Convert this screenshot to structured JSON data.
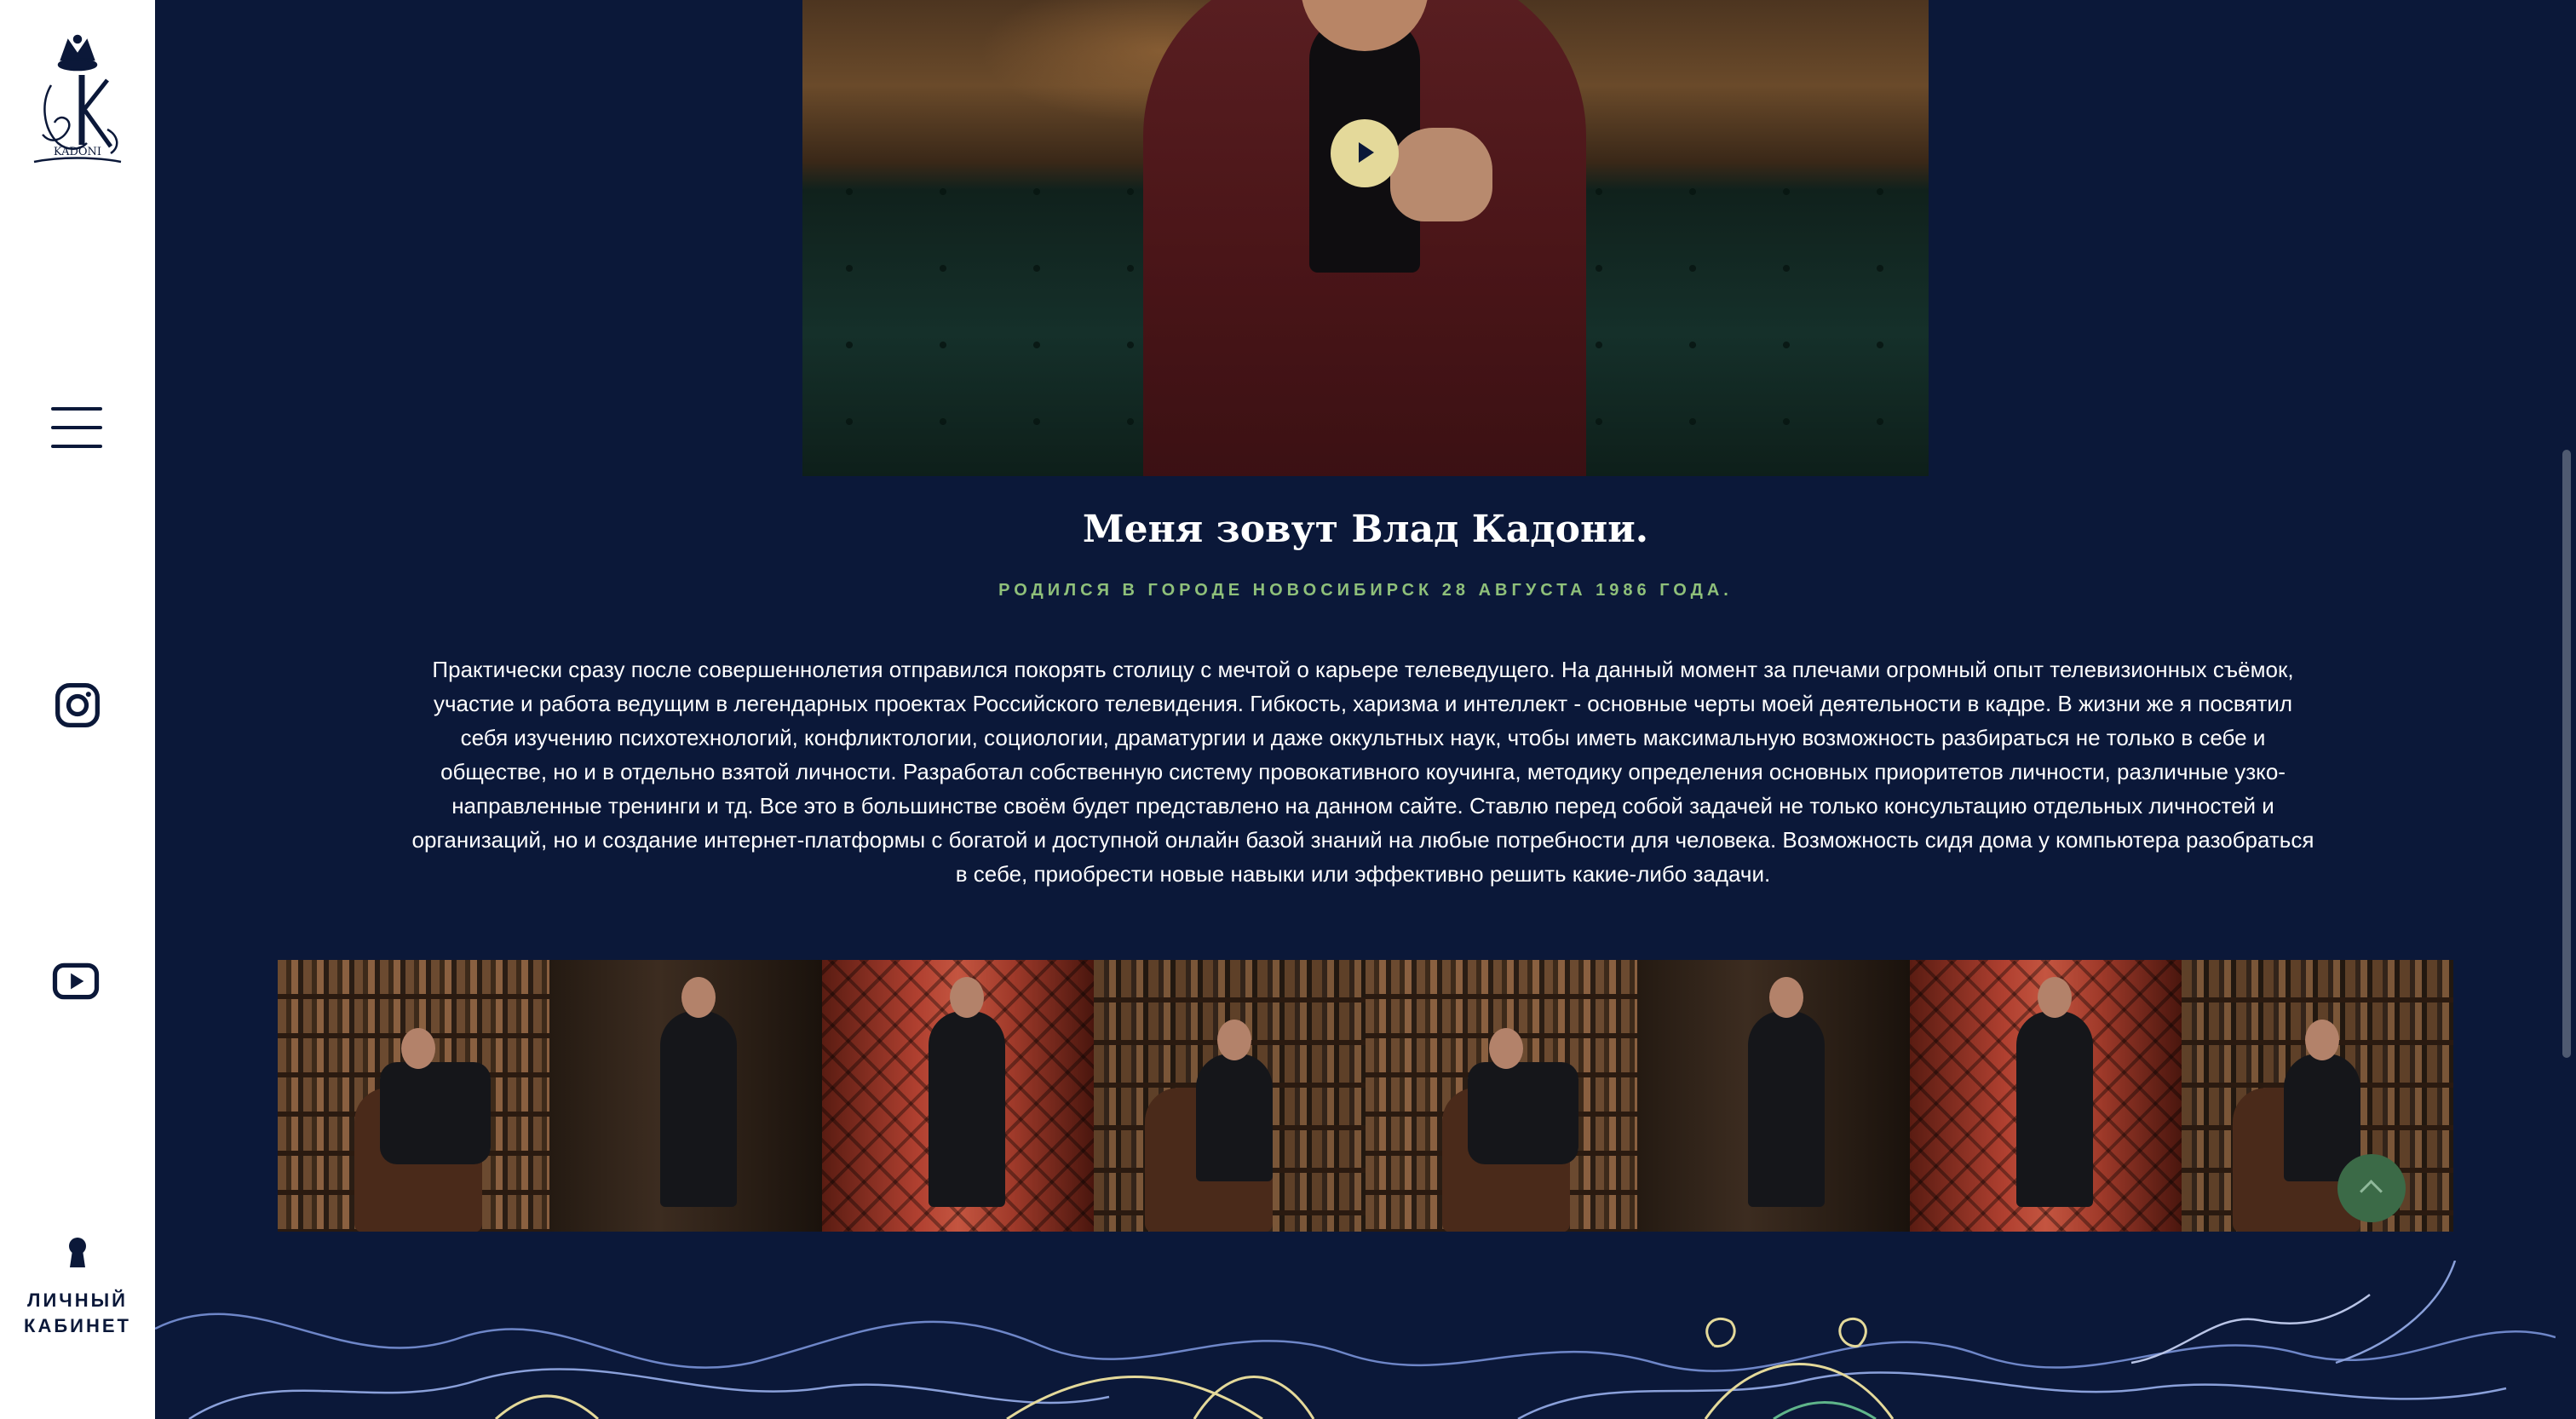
{
  "sidebar": {
    "logo_text": "KADONI",
    "cabinet_label": "ЛИЧНЫЙ\nКАБИНЕТ",
    "social": [
      "instagram-icon",
      "youtube-icon"
    ]
  },
  "hero": {
    "play_icon": "play-icon"
  },
  "about": {
    "title": "Меня зовут Влад Кадони.",
    "subtitle": "РОДИЛСЯ В ГОРОДЕ НОВОСИБИРСК 28 АВГУСТА 1986 ГОДА.",
    "bio": "Практически сразу после совершеннолетия отправился покорять столицу с мечтой о карьере телеведущего. На данный момент за плечами огромный опыт телевизионных съёмок, участие и работа ведущим в легендарных проектах Российского телевидения. Гибкость, харизма и интеллект - основные черты моей деятельности в кадре. В жизни же я посвятил себя изучению психотехнологий, конфликтологии, социологии, драматургии и даже оккультных наук, чтобы иметь максимальную возможность разбираться не только в себе и обществе, но и в отдельно взятой личности. Разработал собственную систему провокативного коучинга, методику определения основных приоритетов личности, различные узко-направленные тренинги и тд. Все это в большинстве своём будет представлено на данном сайте. Ставлю перед собой задачей не только консультацию отдельных личностей и организаций, но и создание интернет-платформы с богатой и доступной онлайн базой знаний на любые потребности для человека. Возможность сидя дома у компьютера разобраться в себе, приобрести новые навыки или эффективно решить какие-либо задачи."
  },
  "colors": {
    "background": "#0b1839",
    "accent_green": "#8fc07a",
    "play_button": "#e4d99a",
    "scroll_top": "#3b6a47"
  }
}
